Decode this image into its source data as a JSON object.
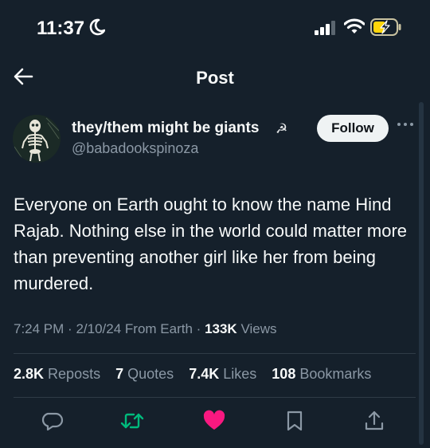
{
  "status_bar": {
    "time": "11:37"
  },
  "header": {
    "title": "Post"
  },
  "author": {
    "display_name": "they/them might be giants",
    "emoji": "☭",
    "handle": "@babadookspinoza",
    "follow_label": "Follow"
  },
  "post": {
    "text": "Everyone on Earth ought to know the name Hind Rajab. Nothing else in the world could matter more than preventing another girl like her from being murdered.",
    "time": "7:24 PM",
    "date": "2/10/24",
    "source": "From Earth",
    "views_count": "133K",
    "views_label": "Views"
  },
  "stats": {
    "reposts_count": "2.8K",
    "reposts_label": "Reposts",
    "quotes_count": "7",
    "quotes_label": "Quotes",
    "likes_count": "7.4K",
    "likes_label": "Likes",
    "bookmarks_count": "108",
    "bookmarks_label": "Bookmarks"
  },
  "colors": {
    "background": "#15202b",
    "repost": "#00ba7c",
    "like": "#f91880",
    "muted": "#8b98a5"
  },
  "icons": [
    "moon-icon",
    "signal-icon",
    "wifi-icon",
    "battery-icon",
    "back-arrow-icon",
    "more-icon",
    "reply-icon",
    "repost-icon",
    "like-icon",
    "bookmark-icon",
    "share-icon"
  ]
}
